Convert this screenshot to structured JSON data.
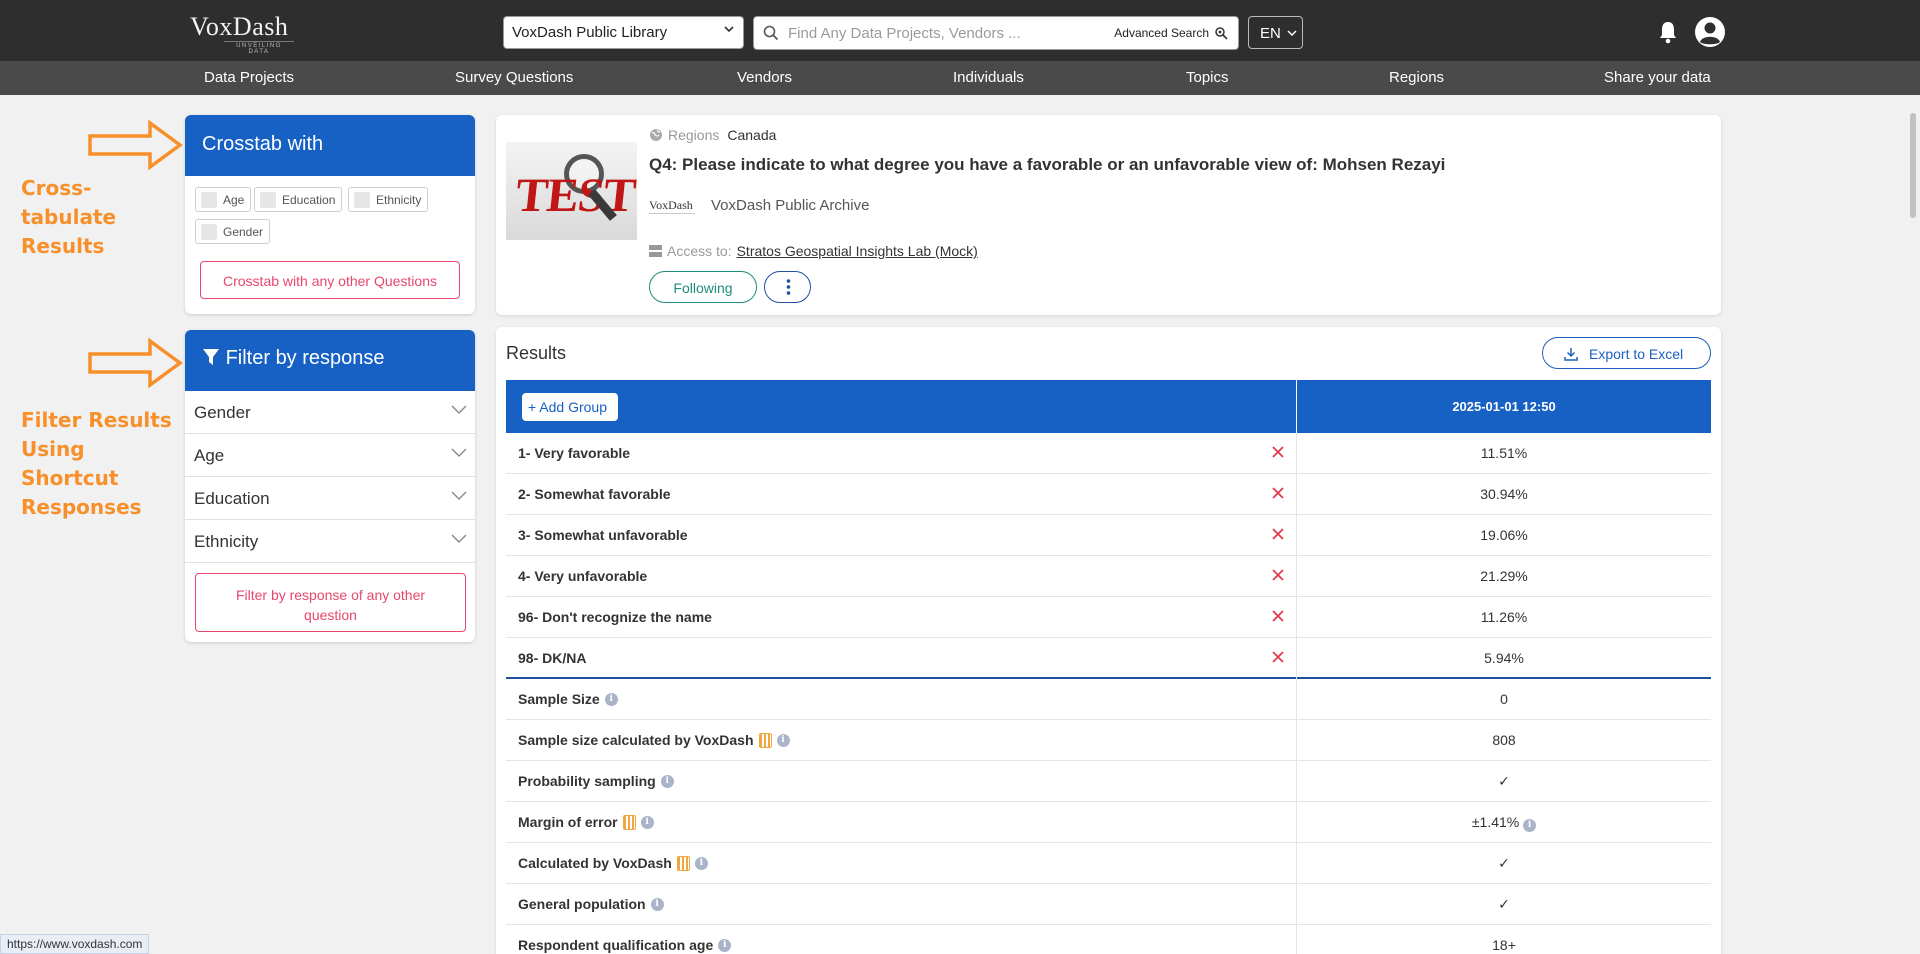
{
  "header": {
    "logo_text": "VoxDash",
    "logo_tagline": "UNVEILING DATA",
    "library_select": "VoxDash Public Library",
    "search_placeholder": "Find Any Data Projects, Vendors ...",
    "advanced_search": "Advanced Search",
    "language": "EN"
  },
  "nav": [
    "Data Projects",
    "Survey Questions",
    "Vendors",
    "Individuals",
    "Topics",
    "Regions",
    "Share your data"
  ],
  "annotations": {
    "crosstab": "Cross-tabulate Results",
    "filter": "Filter Results Using Shortcut Responses"
  },
  "crosstab": {
    "title": "Crosstab with",
    "chips": [
      "Age",
      "Education",
      "Ethnicity",
      "Gender"
    ],
    "other_button": "Crosstab with any other Questions"
  },
  "filter": {
    "title": "Filter by response",
    "rows": [
      "Gender",
      "Age",
      "Education",
      "Ethnicity"
    ],
    "other_button": "Filter by response of any other question"
  },
  "question": {
    "regions_label": "Regions",
    "region": "Canada",
    "title": "Q4: Please indicate to what degree you have a favorable or an unfavorable view of: Mohsen Rezayi",
    "archive_logo": "VoxDash",
    "archive": "VoxDash Public Archive",
    "access_label": "Access to:",
    "access_org": "Stratos Geospatial Insights Lab (Mock)",
    "following_button": "Following"
  },
  "results": {
    "title": "Results",
    "export_button": "Export to Excel",
    "add_group": "+ Add Group",
    "column_date": "2025-01-01 12:50",
    "responses": [
      {
        "label": "1- Very favorable",
        "value": "11.51%"
      },
      {
        "label": "2- Somewhat favorable",
        "value": "30.94%"
      },
      {
        "label": "3- Somewhat unfavorable",
        "value": "19.06%"
      },
      {
        "label": "4- Very unfavorable",
        "value": "21.29%"
      },
      {
        "label": "96- Don't recognize the name",
        "value": "11.26%"
      },
      {
        "label": "98- DK/NA",
        "value": "5.94%"
      }
    ],
    "meta": [
      {
        "label": "Sample Size",
        "value": "0"
      },
      {
        "label": "Sample size calculated by VoxDash",
        "value": "808"
      },
      {
        "label": "Probability sampling",
        "value": "✓"
      },
      {
        "label": "Margin of error",
        "value": "±1.41%"
      },
      {
        "label": "Calculated by VoxDash",
        "value": "✓"
      },
      {
        "label": "General population",
        "value": "✓"
      },
      {
        "label": "Respondent qualification age",
        "value": "18+"
      }
    ]
  },
  "status_url": "https://www.voxdash.com",
  "colors": {
    "primary": "#1760c4",
    "accent": "#e8466c",
    "annotation": "#f7902a",
    "topbar": "#2e2e2e"
  }
}
